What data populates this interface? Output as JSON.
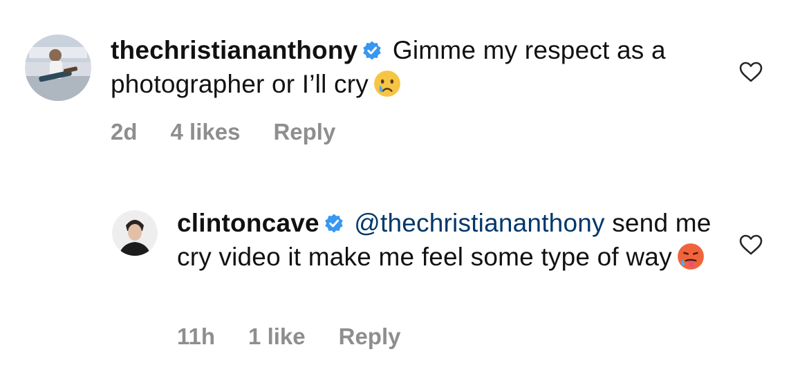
{
  "comments": [
    {
      "username": "thechristiananthony",
      "text": "Gimme my respect as a photographer or I’ll cry",
      "emoji": "crying-face",
      "time": "2d",
      "likes": "4 likes",
      "reply_label": "Reply"
    },
    {
      "username": "clintoncave",
      "mention": "@thechristiananthony",
      "text": "send me cry video it make me feel some type of way",
      "emoji": "hot-face",
      "time": "11h",
      "likes": "1 like",
      "reply_label": "Reply"
    }
  ],
  "colors": {
    "verified_badge": "#3897f0",
    "mention": "#00376b",
    "meta_text": "#8e8e8e"
  }
}
